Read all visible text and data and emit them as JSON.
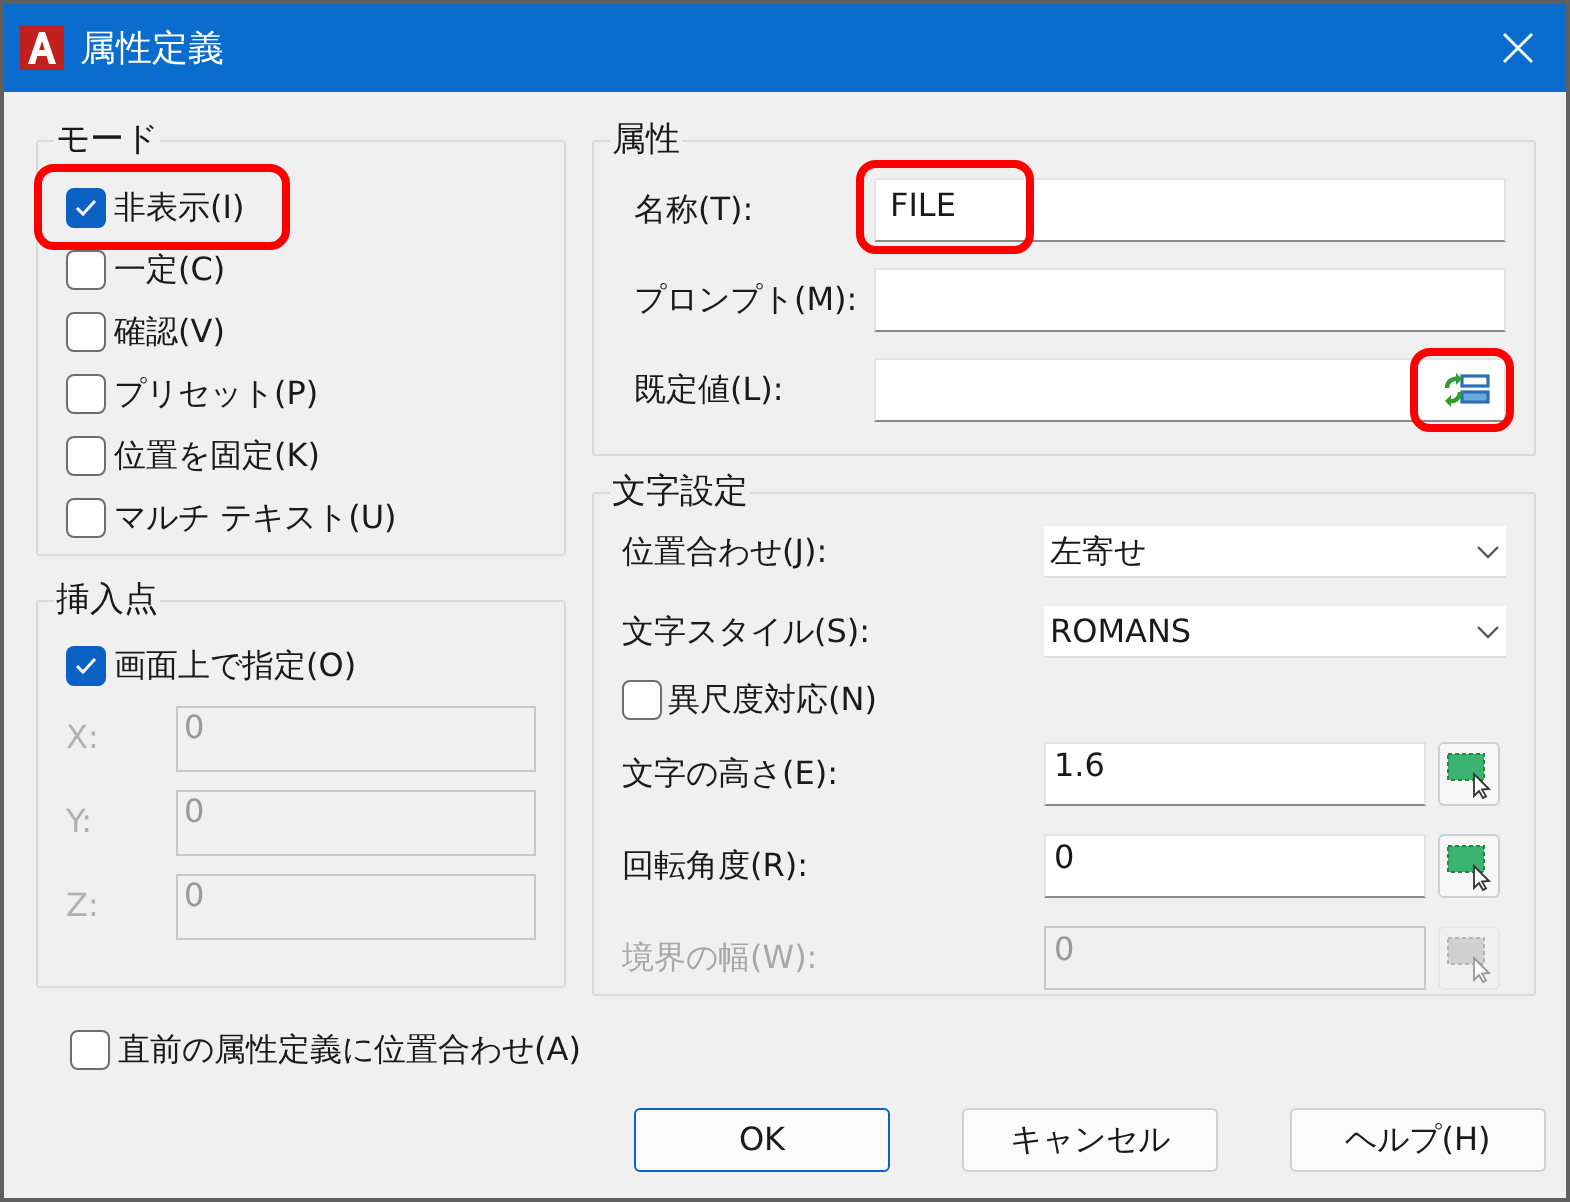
{
  "window": {
    "title": "属性定義"
  },
  "mode": {
    "title": "モード",
    "options": [
      {
        "label": "非表示(I)",
        "checked": true,
        "highlighted": true
      },
      {
        "label": "一定(C)",
        "checked": false,
        "highlighted": false
      },
      {
        "label": "確認(V)",
        "checked": false,
        "highlighted": false
      },
      {
        "label": "プリセット(P)",
        "checked": false,
        "highlighted": false
      },
      {
        "label": "位置を固定(K)",
        "checked": false,
        "highlighted": false
      },
      {
        "label": "マルチ テキスト(U)",
        "checked": false,
        "highlighted": false
      }
    ]
  },
  "insertion_point": {
    "title": "挿入点",
    "specify_on_screen": {
      "label": "画面上で指定(O)",
      "checked": true
    },
    "coordinates": [
      {
        "label": "X:",
        "value": "0",
        "disabled": true
      },
      {
        "label": "Y:",
        "value": "0",
        "disabled": true
      },
      {
        "label": "Z:",
        "value": "0",
        "disabled": true
      }
    ]
  },
  "attribute": {
    "title": "属性",
    "fields": [
      {
        "label": "名称(T):",
        "value": "FILE",
        "highlighted": true,
        "field_button": false
      },
      {
        "label": "プロンプト(M):",
        "highlighted": false,
        "field_button": false
      },
      {
        "label": "既定値(L):",
        "highlighted": false,
        "field_button": true,
        "button_highlighted": true
      }
    ]
  },
  "text_settings": {
    "title": "文字設定",
    "rows": [
      {
        "kind": "dropdown",
        "label": "位置合わせ(J):",
        "value": "左寄せ"
      },
      {
        "kind": "dropdown",
        "label": "文字スタイル(S):",
        "value": "ROMANS"
      },
      {
        "kind": "checkbox",
        "label": "異尺度対応(N)",
        "checked": false
      },
      {
        "kind": "pick",
        "label": "文字の高さ(E):",
        "value": "1.6",
        "disabled": false
      },
      {
        "kind": "pick",
        "label": "回転角度(R):",
        "value": "0",
        "disabled": false
      },
      {
        "kind": "pick",
        "label": "境界の幅(W):",
        "value": "0",
        "disabled": true
      }
    ]
  },
  "align_below": {
    "label": "直前の属性定義に位置合わせ(A)",
    "checked": false
  },
  "buttons": [
    {
      "label": "OK",
      "default": true
    },
    {
      "label": "キャンセル",
      "default": false
    },
    {
      "label": "ヘルプ(H)",
      "default": false
    }
  ]
}
